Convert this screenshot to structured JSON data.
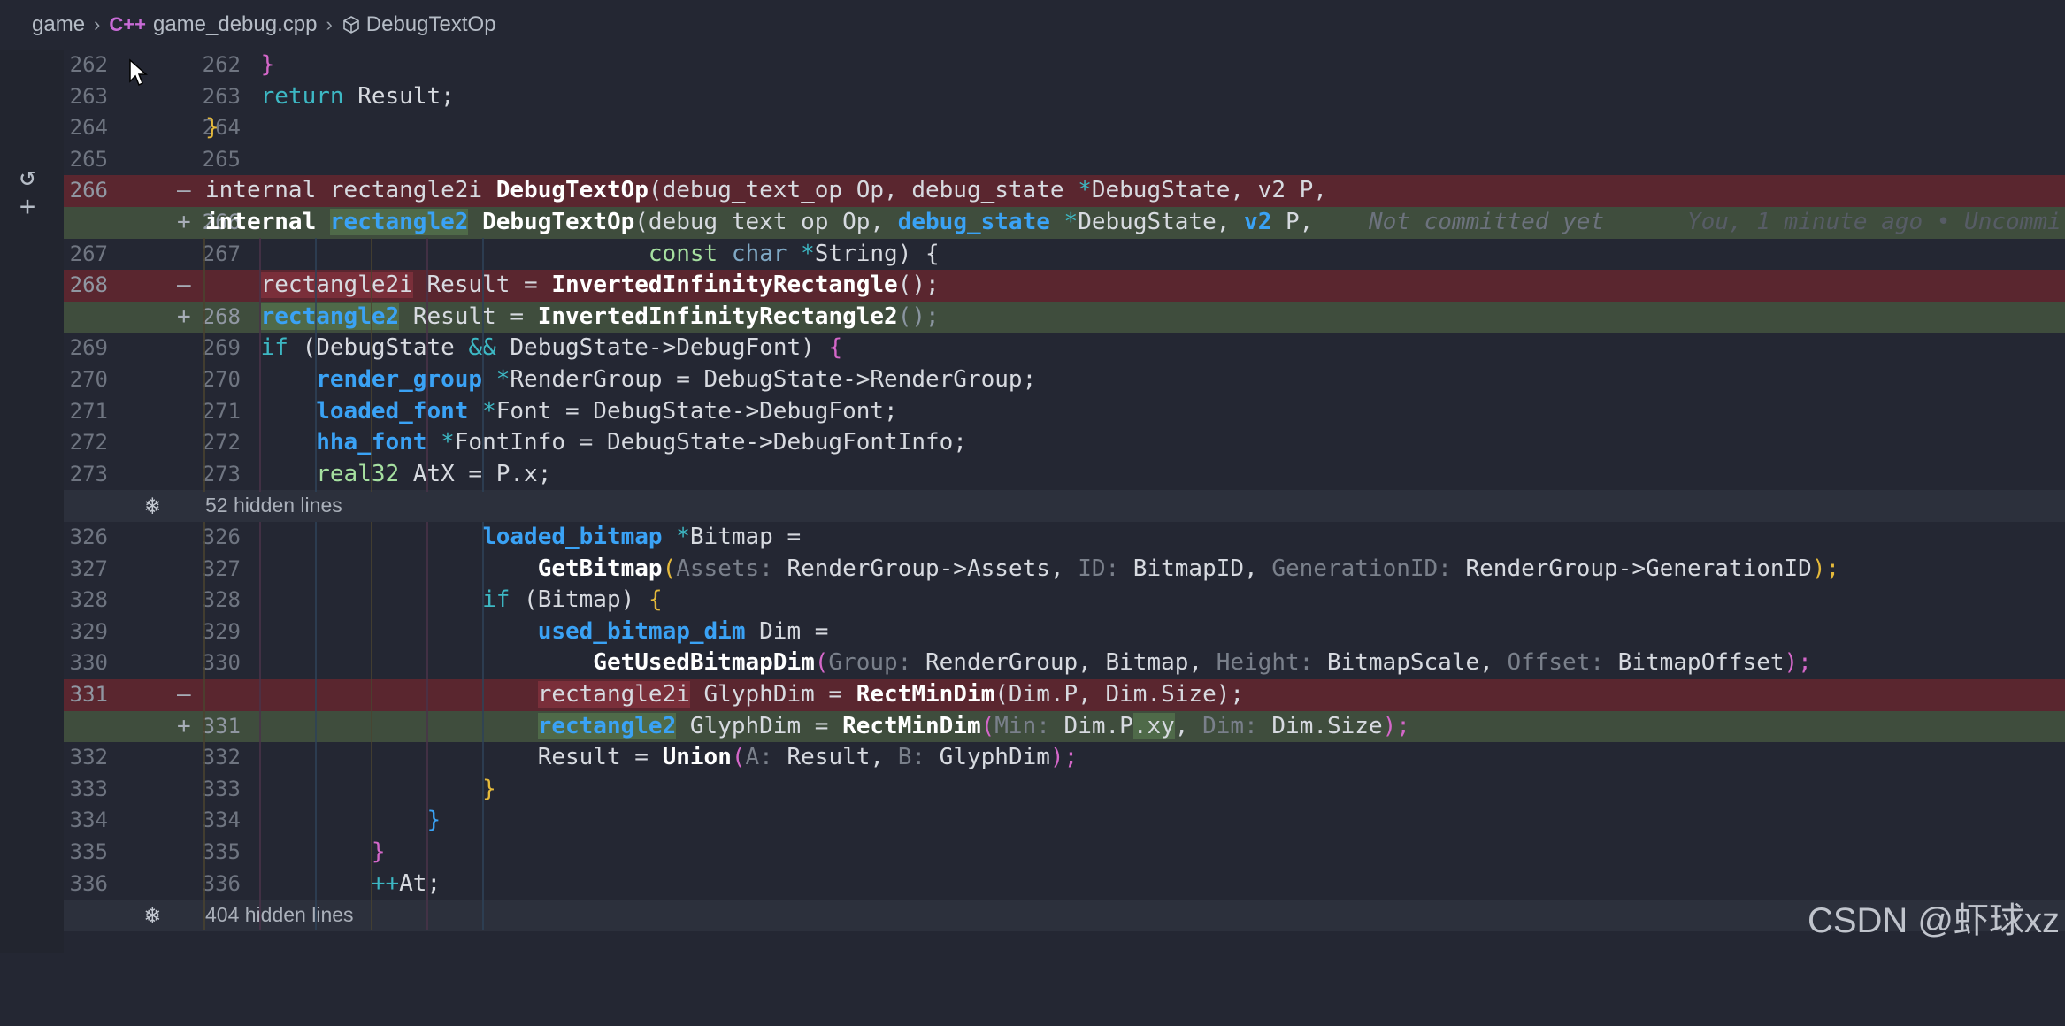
{
  "breadcrumb": {
    "folder": "game",
    "file_icon": "C++",
    "file": "game_debug.cpp",
    "symbol": "DebugTextOp"
  },
  "hidden_blocks": [
    {
      "label": "52 hidden lines"
    },
    {
      "label": "404 hidden lines"
    }
  ],
  "blame": {
    "status": "Not committed yet",
    "author": "You, 1 minute ago • Uncommi"
  },
  "lines": [
    {
      "old": "262",
      "new": "262",
      "mark": ""
    },
    {
      "old": "263",
      "new": "263",
      "mark": ""
    },
    {
      "old": "264",
      "new": "264",
      "mark": ""
    },
    {
      "old": "265",
      "new": "265",
      "mark": ""
    },
    {
      "old": "266",
      "new": "",
      "mark": "—"
    },
    {
      "old": "",
      "new": "266",
      "mark": "+"
    },
    {
      "old": "267",
      "new": "267",
      "mark": ""
    },
    {
      "old": "268",
      "new": "",
      "mark": "—"
    },
    {
      "old": "",
      "new": "268",
      "mark": "+"
    },
    {
      "old": "269",
      "new": "269",
      "mark": ""
    },
    {
      "old": "270",
      "new": "270",
      "mark": ""
    },
    {
      "old": "271",
      "new": "271",
      "mark": ""
    },
    {
      "old": "272",
      "new": "272",
      "mark": ""
    },
    {
      "old": "273",
      "new": "273",
      "mark": ""
    },
    {
      "old": "326",
      "new": "326",
      "mark": ""
    },
    {
      "old": "327",
      "new": "327",
      "mark": ""
    },
    {
      "old": "328",
      "new": "328",
      "mark": ""
    },
    {
      "old": "329",
      "new": "329",
      "mark": ""
    },
    {
      "old": "330",
      "new": "330",
      "mark": ""
    },
    {
      "old": "331",
      "new": "",
      "mark": "—"
    },
    {
      "old": "",
      "new": "331",
      "mark": "+"
    },
    {
      "old": "332",
      "new": "332",
      "mark": ""
    },
    {
      "old": "333",
      "new": "333",
      "mark": ""
    },
    {
      "old": "334",
      "new": "334",
      "mark": ""
    },
    {
      "old": "335",
      "new": "335",
      "mark": ""
    },
    {
      "old": "336",
      "new": "336",
      "mark": ""
    }
  ],
  "code": {
    "l262": "}",
    "l263_kw": "return",
    "l263_rest": " Result;",
    "l264": "}",
    "l266d_a": "internal rectangle2i ",
    "l266d_fn": "DebugTextOp",
    "l266d_b": "(debug_text_op Op, debug_state ",
    "l266d_star": "*",
    "l266d_c": "DebugState, v2 P,",
    "l266a_kw": "internal",
    "l266a_ty": "rectangle2",
    "l266a_fn": "DebugTextOp",
    "l266a_b": "(debug_text_op Op, ",
    "l266a_ty2": "debug_state",
    "l266a_star": " *",
    "l266a_c": "DebugState, ",
    "l266a_ty3": "v2",
    "l266a_d": " P,",
    "l267_kw": "const",
    "l267_ty": "char",
    "l267_star": " *",
    "l267_rest": "String) {",
    "l268d_a": "rectangle2i",
    "l268d_b": " Result = ",
    "l268d_fn": "InvertedInfinityRectangle",
    "l268d_c": "();",
    "l268a_ty": "rectangle2",
    "l268a_b": " Result = ",
    "l268a_fn": "InvertedInfinityRectangle2",
    "l268a_c": "();",
    "l269_kw": "if",
    "l269_a": " (DebugState ",
    "l269_op": "&&",
    "l269_b": " DebugState->DebugFont) ",
    "l269_br": "{",
    "l270_ty": "render_group",
    "l270_star": " *",
    "l270_rest": "RenderGroup = DebugState->RenderGroup;",
    "l271_ty": "loaded_font",
    "l271_star": " *",
    "l271_rest": "Font = DebugState->DebugFont;",
    "l272_ty": "hha_font",
    "l272_star": " *",
    "l272_rest": "FontInfo = DebugState->DebugFontInfo;",
    "l273_ty": "real32",
    "l273_rest": " AtX = P.x;",
    "l326_ty": "loaded_bitmap",
    "l326_star": " *",
    "l326_rest": "Bitmap =",
    "l327_fn": "GetBitmap",
    "l327_h1": "Assets:",
    "l327_a": " RenderGroup->Assets, ",
    "l327_h2": "ID:",
    "l327_b": " BitmapID, ",
    "l327_h3": "GenerationID:",
    "l327_c": " RenderGroup->GenerationID",
    "l327_end": ");",
    "l328_kw": "if",
    "l328_rest": " (Bitmap) ",
    "l329_ty": "used_bitmap_dim",
    "l329_rest": " Dim =",
    "l330_fn": "GetUsedBitmapDim",
    "l330_h1": "Group:",
    "l330_a": " RenderGroup, Bitmap, ",
    "l330_h2": "Height:",
    "l330_b": " BitmapScale, ",
    "l330_h3": "Offset:",
    "l330_c": " BitmapOffset",
    "l330_end": ");",
    "l331d_a": "rectangle2i",
    "l331d_b": " GlyphDim = ",
    "l331d_fn": "RectMinDim",
    "l331d_c": "(Dim.P, Dim.Size);",
    "l331a_ty": "rectangle2",
    "l331a_b": " GlyphDim = ",
    "l331a_fn": "RectMinDim",
    "l331a_h1": "Min:",
    "l331a_c": " Dim.P",
    "l331a_xy": ".xy",
    "l331a_d": ", ",
    "l331a_h2": "Dim:",
    "l331a_e": " Dim.Size",
    "l331a_end": ");",
    "l332_a": "Result = ",
    "l332_fn": "Union",
    "l332_h1": "A:",
    "l332_b": " Result, ",
    "l332_h2": "B:",
    "l332_c": " GlyphDim",
    "l332_end": ");",
    "brace_close": "}",
    "l336_op": "++",
    "l336_rest": "At;",
    "paren_open": "(",
    "paren_close": ")"
  },
  "watermark": "CSDN @虾球xz"
}
